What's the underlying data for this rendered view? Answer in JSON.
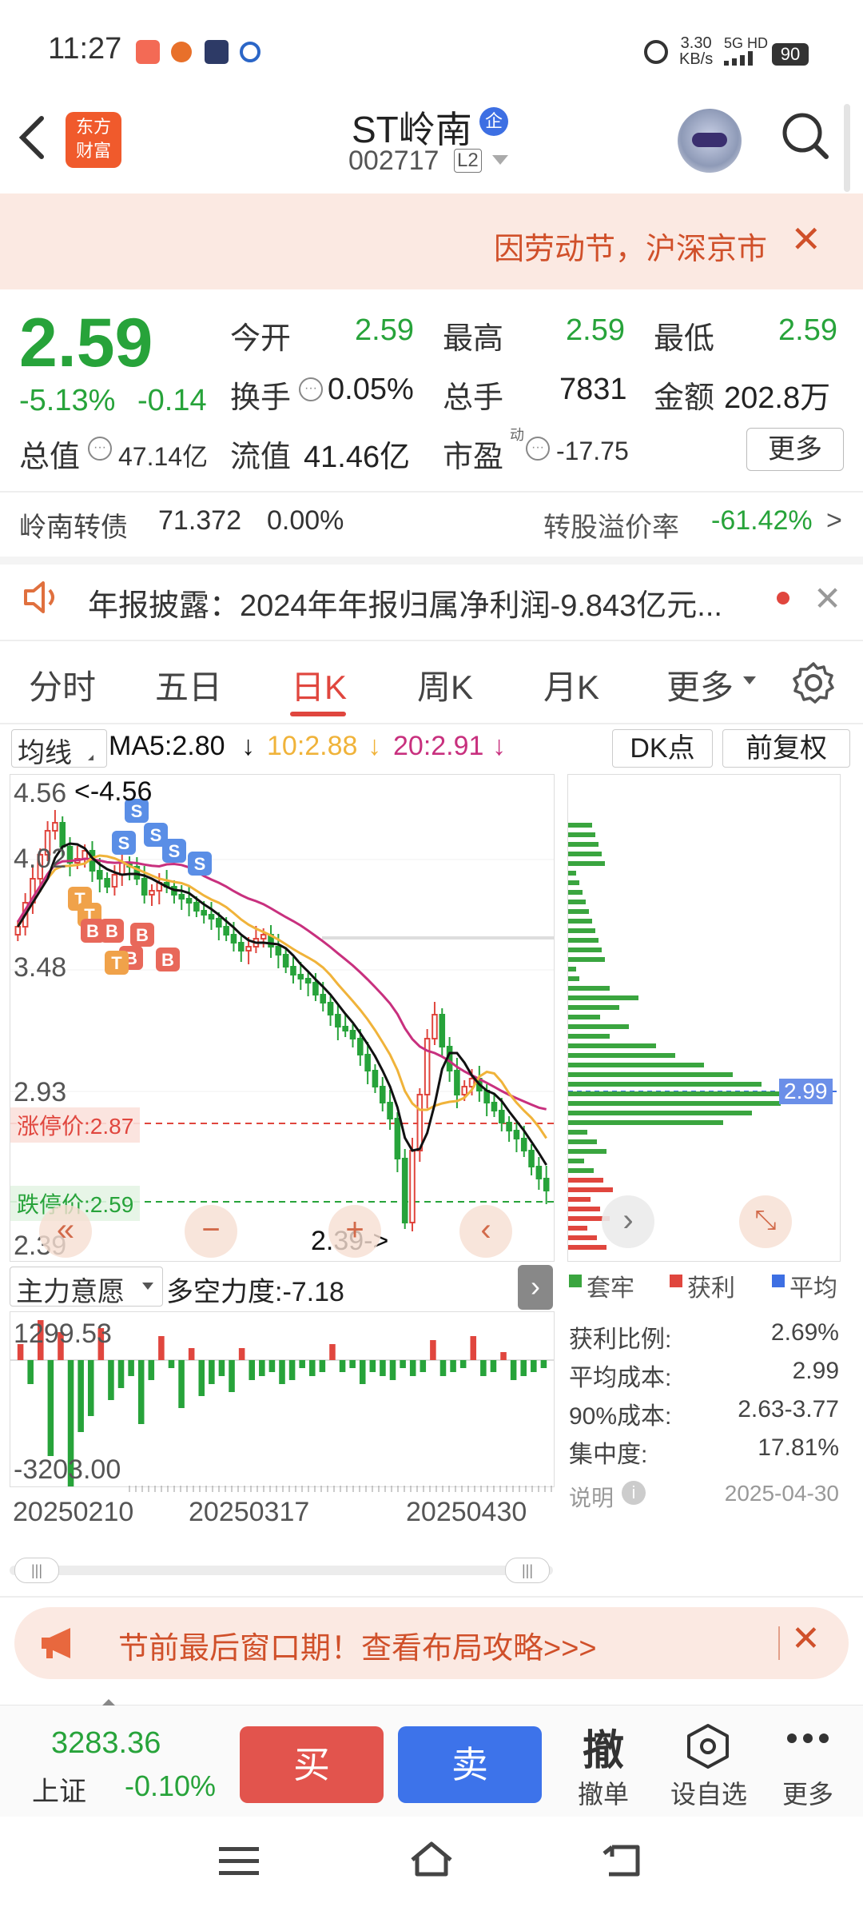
{
  "status_bar": {
    "time": "11:27",
    "net_speed_top": "3.30",
    "net_speed_unit": "KB/s",
    "network": "5G HD",
    "battery": "90"
  },
  "header": {
    "stock_name": "ST岭南",
    "badge": "企",
    "stock_code": "002717",
    "level_tag": "L2",
    "logo_line1": "东方",
    "logo_line2": "财富"
  },
  "notice": {
    "text": "因劳动节，沪深京市",
    "close": "✕"
  },
  "quote": {
    "price": "2.59",
    "change_pct": "-5.13%",
    "change": "-0.14",
    "open_label": "今开",
    "open": "2.59",
    "high_label": "最高",
    "high": "2.59",
    "low_label": "最低",
    "low": "2.59",
    "turnover_label": "换手",
    "turnover": "0.05%",
    "volume_label": "总手",
    "volume": "7831",
    "amount_label": "金额",
    "amount": "202.8万",
    "mcap_label": "总值",
    "mcap": "47.14亿",
    "float_label": "流值",
    "float": "41.46亿",
    "pe_label": "市盈",
    "pe_sup": "动",
    "pe": "-17.75",
    "more": "更多"
  },
  "bond": {
    "name": "岭南转债",
    "price": "71.372",
    "change": "0.00%",
    "premium_label": "转股溢价率",
    "premium": "-61.42%",
    "arrow": ">"
  },
  "report": {
    "text": "年报披露：2024年年报归属净利润-9.843亿元..."
  },
  "tabs": [
    "分时",
    "五日",
    "日K",
    "周K",
    "月K",
    "更多"
  ],
  "chart": {
    "ma_selector": "均线",
    "ma5": "MA5:2.80",
    "ma10": "10:2.88",
    "ma20": "20:2.91",
    "dk_label": "DK点",
    "adjust_label": "前复权",
    "y_top": "4.56",
    "y_top_note": "<-4.56",
    "y2": "4.02",
    "y3": "3.48",
    "y4": "2.93",
    "y_bottom": "2.39",
    "y_bottom_note": "2.39->",
    "limit_up_label": "涨停价:2.87",
    "limit_down_label": "跌停价:2.59",
    "chip_price": "2.99",
    "indicator_name": "主力意愿",
    "indicator_value": "多空力度:-7.18",
    "ind_top": "1299.53",
    "ind_bottom": "-3203.00",
    "dates": [
      "20250210",
      "20250317",
      "20250430"
    ],
    "colors": {
      "up": "#e0463e",
      "down": "#27a33a",
      "ma5": "#111111",
      "ma10": "#f0b33a",
      "ma20": "#c8307e"
    }
  },
  "chip": {
    "legend": [
      "套牢",
      "获利",
      "平均"
    ],
    "stats": [
      {
        "label": "获利比例:",
        "value": "2.69%"
      },
      {
        "label": "平均成本:",
        "value": "2.99"
      },
      {
        "label": "90%成本:",
        "value": "2.63-3.77"
      },
      {
        "label": "集中度:",
        "value": "17.81%"
      }
    ],
    "note_label": "说明",
    "date": "2025-04-30"
  },
  "banner": {
    "text": "节前最后窗口期！查看布局攻略>>>",
    "close": "✕"
  },
  "toolbar": {
    "index_value": "3283.36",
    "index_name": "上证",
    "index_change": "-0.10%",
    "buy": "买",
    "sell": "卖",
    "cancel_icon": "撤",
    "cancel_label": "撤单",
    "watch_label": "设自选",
    "more_label": "更多"
  }
}
